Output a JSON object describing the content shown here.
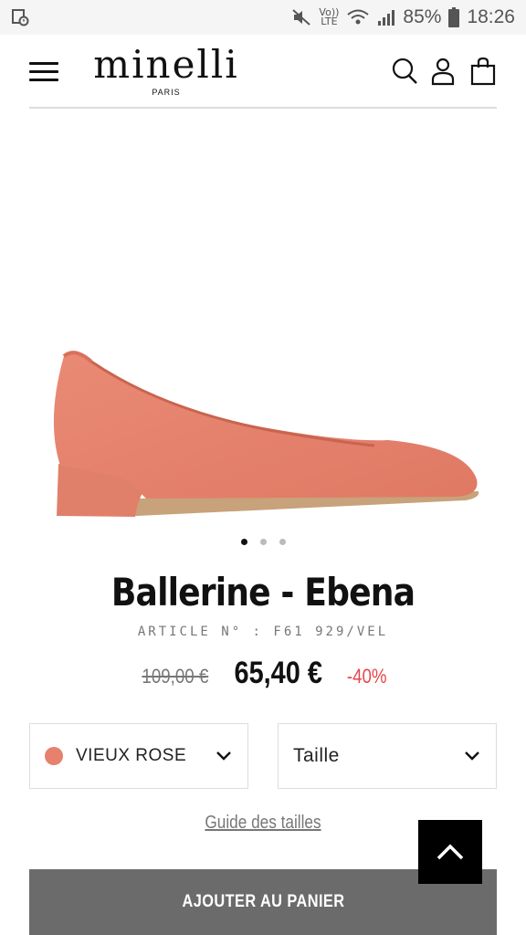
{
  "status_bar": {
    "volte_top": "Vo))",
    "volte_bottom": "LTE",
    "battery": "85%",
    "time": "18:26"
  },
  "header": {
    "logo_brand": "minelli",
    "logo_city": "PARIS",
    "icons": [
      "menu-icon",
      "search-icon",
      "account-icon",
      "bag-icon"
    ]
  },
  "product": {
    "title": "Ballerine - Ebena",
    "article": "ARTICLE N° : F61 929/VEL",
    "price_old": "109,00 €",
    "price_new": "65,40 €",
    "discount": "-40%",
    "carousel": {
      "count": 3,
      "active_index": 0
    }
  },
  "options": {
    "color_label": "VIEUX ROSE",
    "color_hex": "#e8806e",
    "size_label": "Taille"
  },
  "links": {
    "size_guide": "Guide des tailles"
  },
  "actions": {
    "add_to_cart": "AJOUTER AU PANIER"
  },
  "colors": {
    "discount": "#e8474b",
    "cart_button": "#6b6b6b",
    "shoe": "#e5826e"
  }
}
